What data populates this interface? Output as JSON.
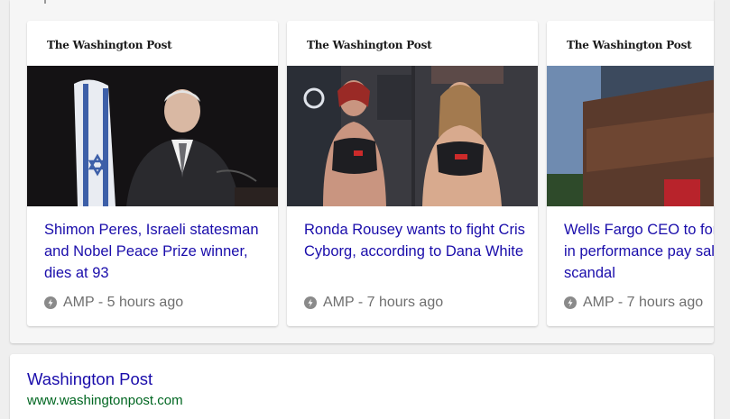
{
  "top_stories": {
    "cards": [
      {
        "publisher_logo": "The Washington Post",
        "image_description": "photo-elderly-man-with-israeli-flag",
        "headline": "Shimon Peres, Israeli statesman and Nobel Peace Prize winner, dies at 93",
        "amp_icon": "amp-bolt-icon",
        "meta": "AMP - 5 hours ago"
      },
      {
        "publisher_logo": "The Washington Post",
        "image_description": "photo-two-female-fighters-weigh-in",
        "headline": "Ronda Rousey wants to fight Cris Cyborg, according to Dana White",
        "amp_icon": "amp-bolt-icon",
        "meta": "AMP - 7 hours ago"
      },
      {
        "publisher_logo": "The Washington Post",
        "image_description": "photo-wells-fargo-building-sign",
        "headline": "Wells Fargo CEO to forfeit million in performance pay sales scandal",
        "amp_icon": "amp-bolt-icon",
        "meta": "AMP - 7 hours ago"
      }
    ]
  },
  "result": {
    "title": "Washington Post",
    "url": "www.washingtonpost.com"
  },
  "colors": {
    "link": "#1a0dab",
    "url": "#006621",
    "meta": "#6f6f6f",
    "background": "#efefef"
  }
}
